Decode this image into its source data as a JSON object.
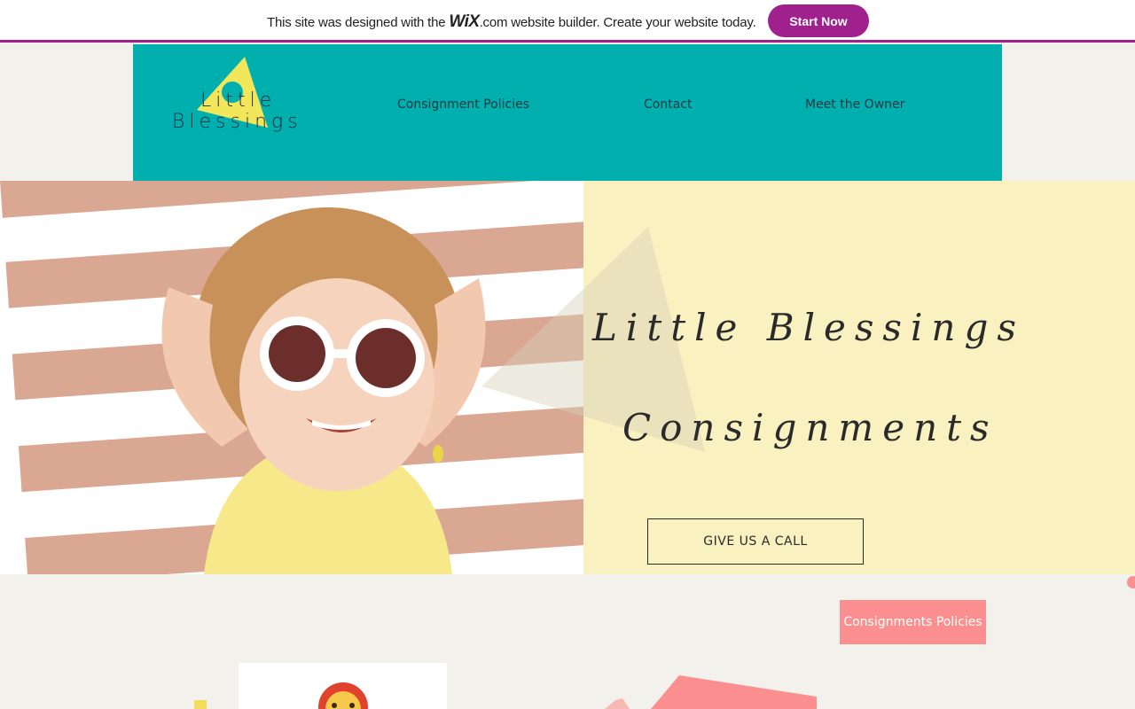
{
  "banner": {
    "message_before": "This site was designed with the ",
    "wix_logo": "WiX",
    "message_after": ".com website builder. Create your website today.",
    "start_button": "Start Now"
  },
  "header": {
    "logo_line1": "Little",
    "logo_line2": "Blessings",
    "nav": [
      "Consignment Policies",
      "Contact",
      "Meet the Owner"
    ]
  },
  "hero": {
    "title_line1": "Little Blessings",
    "title_line2": "Consignments",
    "call_button": "GIVE US A CALL"
  },
  "section": {
    "policies_button": "Consignments Policies"
  },
  "colors": {
    "brand_purple": "#a0208e",
    "header_teal": "#00afae",
    "hero_yellow": "#f9f1c0",
    "accent_pink": "#fb8f8f",
    "logo_yellow": "#f2e65a"
  }
}
